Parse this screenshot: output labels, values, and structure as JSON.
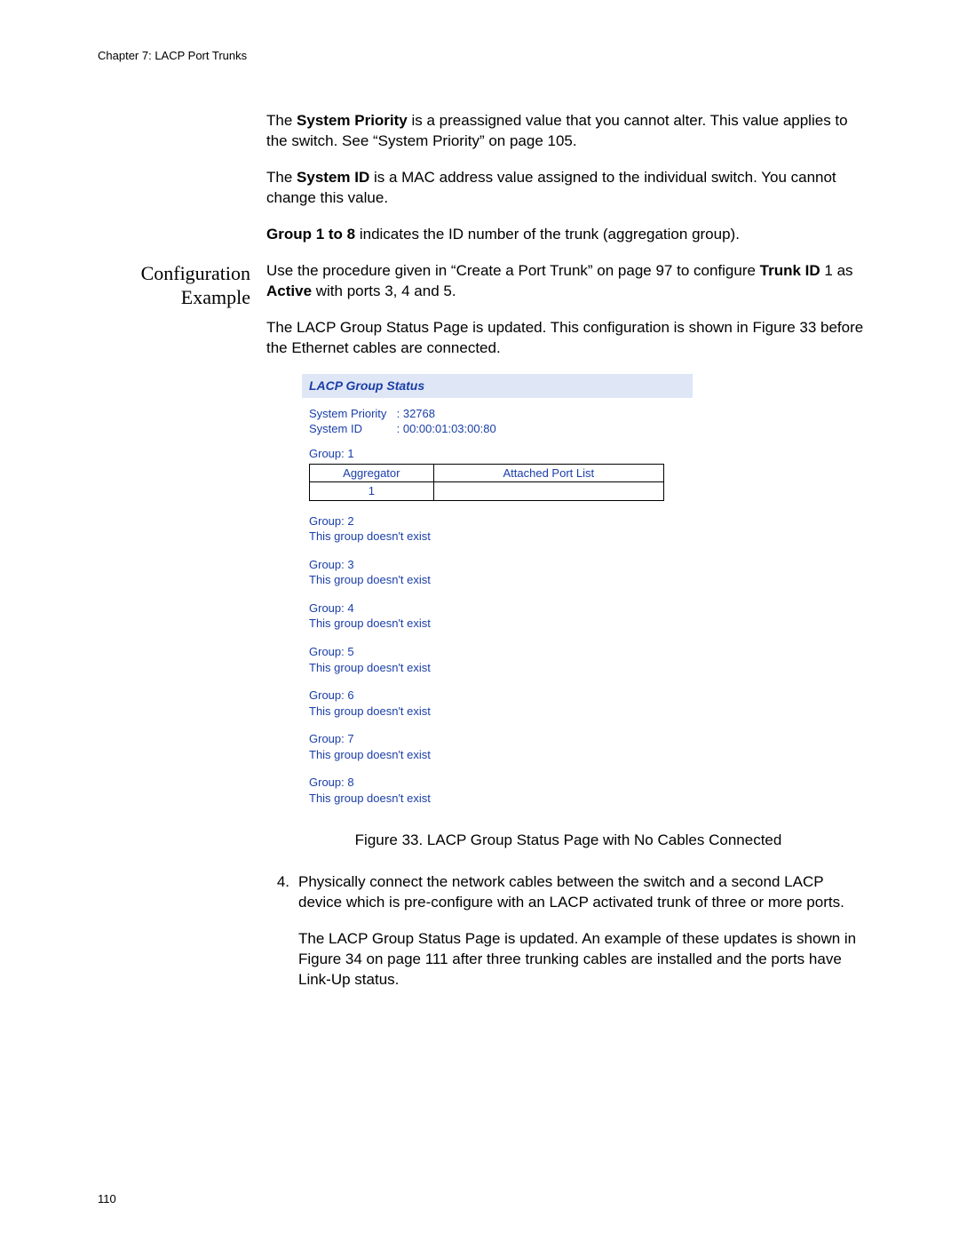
{
  "running_head": "Chapter 7: LACP Port Trunks",
  "page_number": "110",
  "intro": {
    "p1_a": "The ",
    "p1_b": "System Priority",
    "p1_c": " is a preassigned value that you cannot alter. This value applies to the switch. See “System Priority” on page 105.",
    "p2_a": "The ",
    "p2_b": "System ID",
    "p2_c": " is a MAC address value assigned to the individual switch. You cannot change this value.",
    "p3_a": "Group 1 to 8",
    "p3_b": " indicates the ID number of the trunk (aggregation group)."
  },
  "section_title": "Configuration\nExample",
  "config": {
    "p1_a": "Use the procedure given in “Create a Port Trunk” on page 97 to configure ",
    "p1_b": "Trunk ID",
    "p1_c": " 1 as ",
    "p1_d": "Active",
    "p1_e": " with ports 3, 4 and 5.",
    "p2": "The LACP Group Status Page is updated. This configuration is shown in Figure 33 before the Ethernet cables are connected."
  },
  "panel": {
    "title": "LACP Group Status",
    "sys_priority_label": "System Priority",
    "sys_priority_value": ": 32768",
    "sys_id_label": "System ID",
    "sys_id_value": ": 00:00:01:03:00:80",
    "group1_label": "Group: 1",
    "table_col_a": "Aggregator",
    "table_col_b": "Attached Port List",
    "table_val_a": "1",
    "table_val_b": "",
    "groups_rest": [
      {
        "label": "Group: 2",
        "msg": "This group doesn't exist"
      },
      {
        "label": "Group: 3",
        "msg": "This group doesn't exist"
      },
      {
        "label": "Group: 4",
        "msg": "This group doesn't exist"
      },
      {
        "label": "Group: 5",
        "msg": "This group doesn't exist"
      },
      {
        "label": "Group: 6",
        "msg": "This group doesn't exist"
      },
      {
        "label": "Group: 7",
        "msg": "This group doesn't exist"
      },
      {
        "label": "Group: 8",
        "msg": "This group doesn't exist"
      }
    ]
  },
  "figure_caption": "Figure 33. LACP Group Status Page with No Cables Connected",
  "step4": {
    "num": "4.",
    "text": "Physically connect the network cables between the switch and a second LACP device which is pre-configure with an LACP activated trunk of three or more ports.",
    "follow": "The LACP Group Status Page is updated. An example of these updates is shown in Figure 34 on page 111 after three trunking cables are installed and the ports have Link-Up status."
  }
}
